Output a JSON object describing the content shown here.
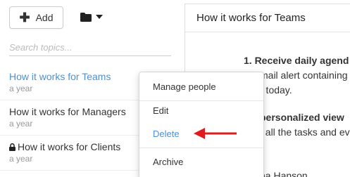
{
  "toolbar": {
    "add_label": "Add",
    "add_icon": "plus-icon",
    "folder_icon": "folder-icon",
    "dropdown_icon": "caret-down-icon"
  },
  "search": {
    "placeholder": "Search topics..."
  },
  "topics": [
    {
      "title": "How it works for Teams",
      "meta": "a year",
      "active": true
    },
    {
      "title": "How it works for Managers",
      "meta": "a year"
    },
    {
      "title": "How it works for Clients",
      "meta": "a year",
      "locked": true,
      "icon": "lock-icon"
    }
  ],
  "detail": {
    "title": "How it works for Teams",
    "lines": [
      "1. Receive daily agend",
      "mail alert containing",
      "r today.",
      "personalized view",
      "f all the tasks and ev",
      "na Hanson"
    ]
  },
  "context_menu": {
    "items": [
      "Manage people",
      "Edit",
      "Delete",
      "Archive"
    ],
    "highlighted": "Delete"
  },
  "colors": {
    "accent": "#4a90d9",
    "arrow": "#e01b1b"
  }
}
